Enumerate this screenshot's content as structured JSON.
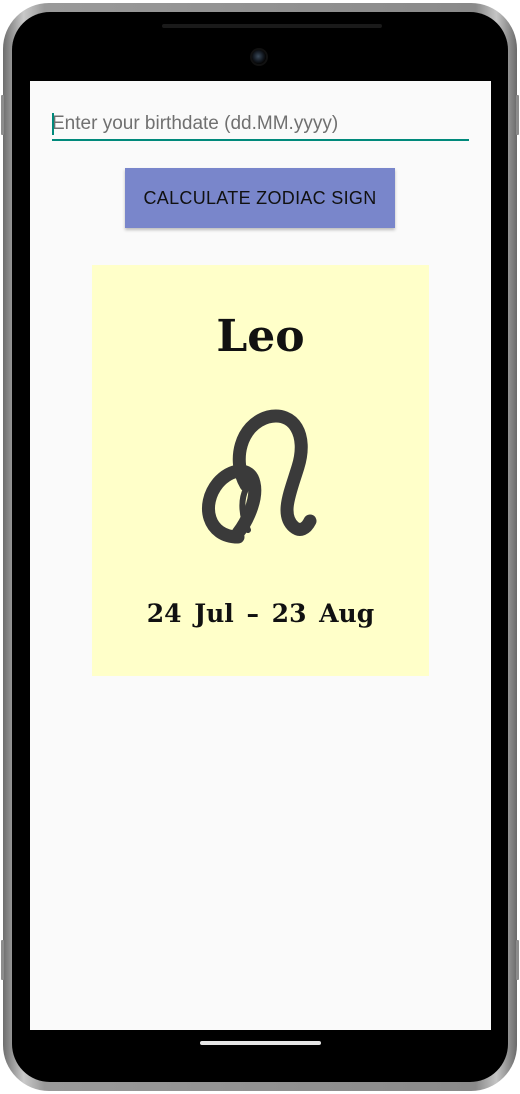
{
  "input": {
    "placeholder": "Enter your birthdate (dd.MM.yyyy)",
    "value": ""
  },
  "calculate_button": {
    "label": "CALCULATE ZODIAC SIGN"
  },
  "result": {
    "sign_name": "Leo",
    "symbol_icon": "leo-symbol-icon",
    "date_range": "24 Jul – 23 Aug"
  },
  "colors": {
    "accent": "#00897b",
    "button": "#7986cb",
    "card_background": "#ffffc9",
    "screen_background": "#fafafa"
  }
}
